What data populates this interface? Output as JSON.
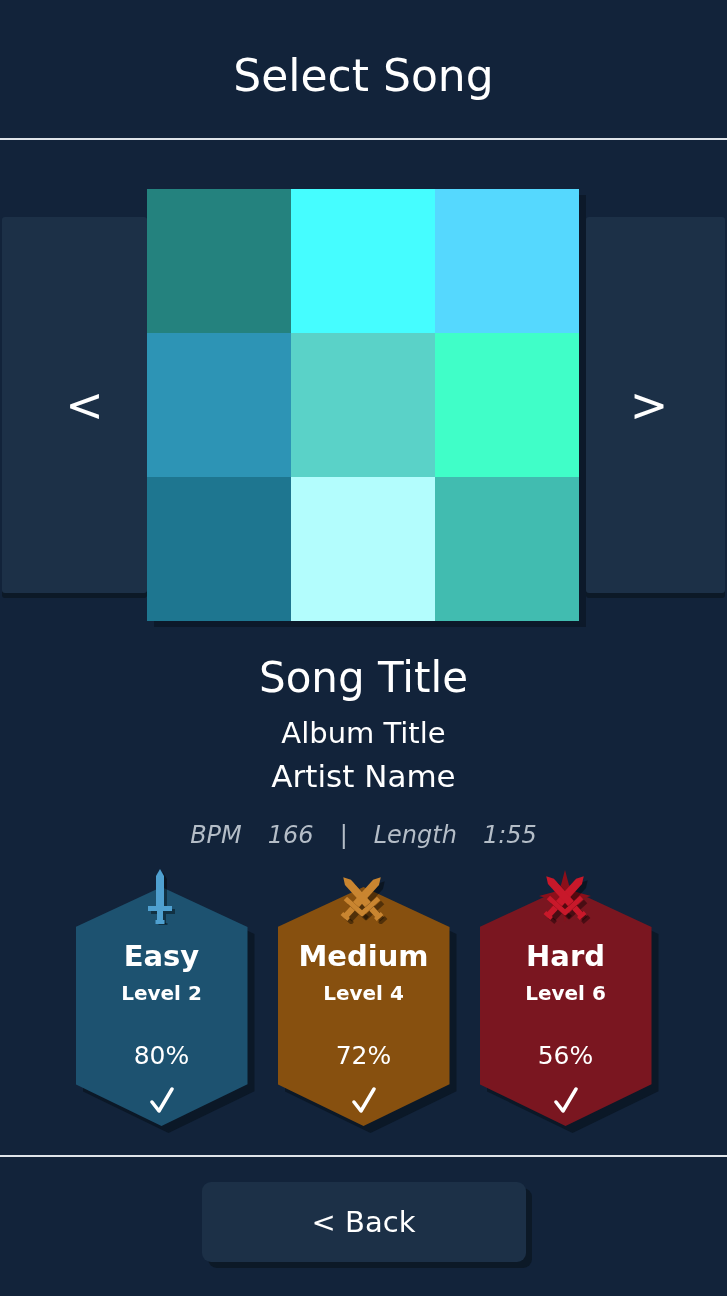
{
  "header": {
    "title": "Select Song"
  },
  "carousel": {
    "previous": "<",
    "next": ">"
  },
  "song": {
    "title": "Song Title",
    "album": "Album Title",
    "artist": "Artist Name"
  },
  "stats": {
    "items": [
      {
        "label": "BPM",
        "value": "166"
      },
      {
        "label": "Length",
        "value": "1:55"
      }
    ],
    "separator": "|"
  },
  "difficulties": [
    {
      "kind": "easy",
      "name": "Easy",
      "rank": "Level 2",
      "score": "80%",
      "completed": true,
      "color": "#1d5270"
    },
    {
      "kind": "medium",
      "name": "Medium",
      "rank": "Level 4",
      "score": "72%",
      "completed": true,
      "color": "#87500f"
    },
    {
      "kind": "hard",
      "name": "Hard",
      "rank": "Level 6",
      "score": "56%",
      "completed": true,
      "color": "#7a1620"
    }
  ],
  "back_button": {
    "label": "< Back"
  }
}
